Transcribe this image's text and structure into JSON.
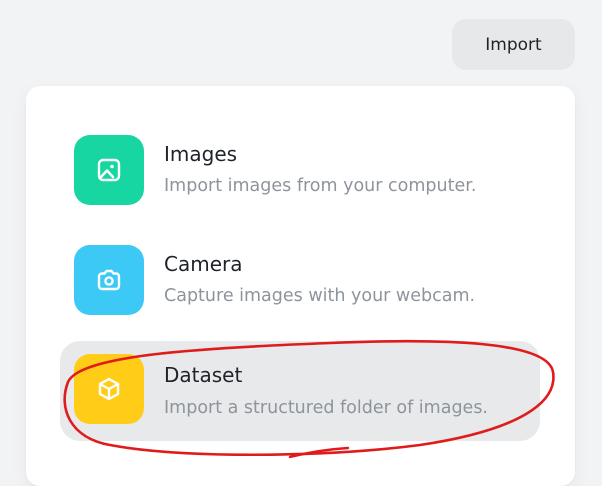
{
  "header": {
    "import_button_label": "Import"
  },
  "menu": {
    "items": [
      {
        "title": "Images",
        "description": "Import images from your computer.",
        "icon": "image-icon",
        "color": "#18d6a2"
      },
      {
        "title": "Camera",
        "description": "Capture images with your webcam.",
        "icon": "camera-icon",
        "color": "#3cc9f6"
      },
      {
        "title": "Dataset",
        "description": "Import a structured folder of images.",
        "icon": "box-icon",
        "color": "#ffcc18",
        "highlighted": true
      }
    ]
  },
  "annotation": {
    "type": "freehand-ellipse",
    "color": "#e01b1b",
    "target": "Dataset"
  }
}
